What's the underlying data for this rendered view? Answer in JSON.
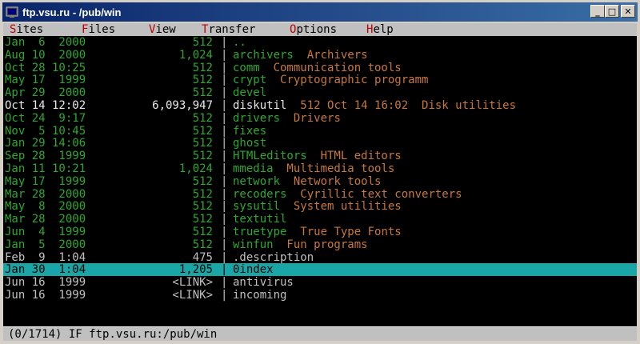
{
  "window": {
    "title": "ftp.vsu.ru - /pub/win"
  },
  "title_buttons": {
    "minimize": "_",
    "maximize": "□",
    "close": "✕"
  },
  "menu": [
    {
      "hot": "S",
      "rest": "ites"
    },
    {
      "hot": "F",
      "rest": "iles"
    },
    {
      "hot": "V",
      "rest": "iew"
    },
    {
      "hot": "T",
      "rest": "ransfer"
    },
    {
      "hot": "O",
      "rest": "ptions"
    },
    {
      "hot": "H",
      "rest": "elp"
    }
  ],
  "files": [
    {
      "date": "Jan  6  2000",
      "size": "512",
      "name": "..",
      "desc": "",
      "style": "green"
    },
    {
      "date": "Aug 10  2000",
      "size": "1,024",
      "name": "archivers",
      "desc": "Archivers",
      "style": "green"
    },
    {
      "date": "Oct 28 10:25",
      "size": "512",
      "name": "comm",
      "desc": "Communication tools",
      "style": "green"
    },
    {
      "date": "May 17  1999",
      "size": "512",
      "name": "crypt",
      "desc": "Cryptographic programm",
      "style": "green"
    },
    {
      "date": "Apr 29  2000",
      "size": "512",
      "name": "devel",
      "desc": "",
      "style": "green"
    },
    {
      "date": "Oct 14 12:02",
      "size": "6,093,947",
      "name": "diskutil",
      "desc": "512 Oct 14 16:02  Disk utilities",
      "style": "bright"
    },
    {
      "date": "Oct 24  9:17",
      "size": "512",
      "name": "drivers",
      "desc": "Drivers",
      "style": "green"
    },
    {
      "date": "Nov  5 10:45",
      "size": "512",
      "name": "fixes",
      "desc": "",
      "style": "green"
    },
    {
      "date": "Jan 29 14:06",
      "size": "512",
      "name": "ghost",
      "desc": "",
      "style": "green"
    },
    {
      "date": "Sep 28  1999",
      "size": "512",
      "name": "HTMLeditors",
      "desc": "HTML editors",
      "style": "green"
    },
    {
      "date": "Jan 11 10:21",
      "size": "1,024",
      "name": "mmedia",
      "desc": "Multimedia tools",
      "style": "green"
    },
    {
      "date": "May 17  1999",
      "size": "512",
      "name": "network",
      "desc": "Network tools",
      "style": "green"
    },
    {
      "date": "Mar 28  2000",
      "size": "512",
      "name": "recoders",
      "desc": "Cyrillic text converters",
      "style": "green"
    },
    {
      "date": "May  8  2000",
      "size": "512",
      "name": "sysutil",
      "desc": "System utilities",
      "style": "green"
    },
    {
      "date": "Mar 28  2000",
      "size": "512",
      "name": "textutil",
      "desc": "",
      "style": "green"
    },
    {
      "date": "Jun  4  1999",
      "size": "512",
      "name": "truetype",
      "desc": "True Type Fonts",
      "style": "green"
    },
    {
      "date": "Jan  5  2000",
      "size": "512",
      "name": "winfun",
      "desc": "Fun programs",
      "style": "green"
    },
    {
      "date": "Feb  9  1:04",
      "size": "475",
      "name": ".description",
      "desc": "",
      "style": "gray"
    },
    {
      "date": "Jan 30  1:04",
      "size": "1,205",
      "name": "0index",
      "desc": "",
      "style": "selected"
    },
    {
      "date": "Jun 16  1999",
      "size": "<LINK>",
      "name": "antivirus",
      "desc": "",
      "style": "gray"
    },
    {
      "date": "Jun 16  1999",
      "size": "<LINK>",
      "name": "incoming",
      "desc": "",
      "style": "gray"
    }
  ],
  "separator": "|",
  "status": {
    "text": "(0/1714) IF ftp.vsu.ru:/pub/win"
  },
  "colors": {
    "dir": "#2ea82e",
    "desc": "#c8783a",
    "selected_bg": "#1aa6a6",
    "title_start": "#0a246a"
  }
}
